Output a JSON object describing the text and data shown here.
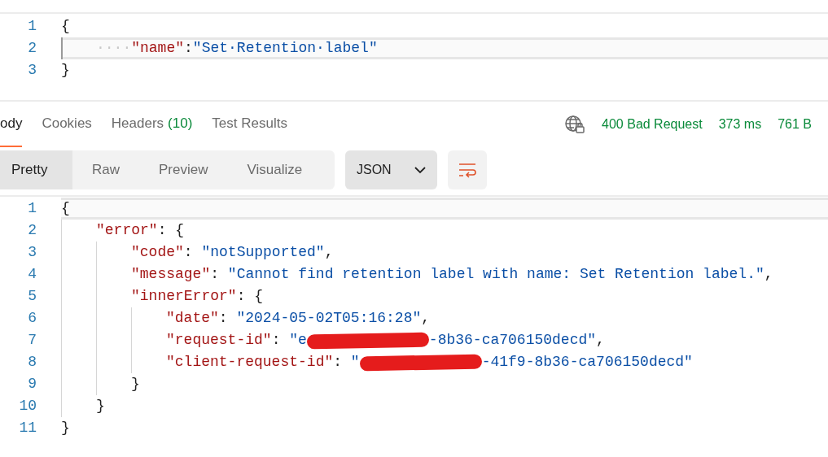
{
  "request_editor": {
    "lines": [
      {
        "number": "1",
        "active": false,
        "tokens": [
          {
            "kind": "open",
            "text": "{"
          }
        ]
      },
      {
        "number": "2",
        "active": true,
        "tokens": [
          {
            "kind": "ws",
            "text": "····"
          },
          {
            "kind": "key",
            "text": "\"name\""
          },
          {
            "kind": "punct",
            "text": ":"
          },
          {
            "kind": "string",
            "text": "\"Set·Retention·label\""
          }
        ]
      },
      {
        "number": "3",
        "active": false,
        "tokens": [
          {
            "kind": "close",
            "text": "}"
          }
        ]
      }
    ]
  },
  "response_tabs": [
    {
      "label": "ody",
      "selected": true
    },
    {
      "label": "Cookies",
      "selected": false
    },
    {
      "label": "Headers",
      "count": "(10)",
      "selected": false
    },
    {
      "label": "Test Results",
      "selected": false
    }
  ],
  "status": {
    "code": "400 Bad Request",
    "time": "373 ms",
    "size": "761 B"
  },
  "view_modes": [
    {
      "label": "Pretty",
      "selected": true
    },
    {
      "label": "Raw",
      "selected": false
    },
    {
      "label": "Preview",
      "selected": false
    },
    {
      "label": "Visualize",
      "selected": false
    }
  ],
  "format_dropdown": {
    "value": "JSON"
  },
  "response_editor": {
    "lines": [
      {
        "number": "1",
        "active": true,
        "tokens": [
          {
            "kind": "open",
            "text": "{"
          }
        ]
      },
      {
        "number": "2",
        "active": false,
        "tokens": [
          {
            "kind": "key",
            "text": "\"error\""
          },
          {
            "kind": "punct",
            "text": ": "
          },
          {
            "kind": "open",
            "text": "{"
          }
        ]
      },
      {
        "number": "3",
        "active": false,
        "tokens": [
          {
            "kind": "key",
            "text": "\"code\""
          },
          {
            "kind": "punct",
            "text": ": "
          },
          {
            "kind": "string",
            "text": "\"notSupported\""
          },
          {
            "kind": "punct",
            "text": ","
          }
        ]
      },
      {
        "number": "4",
        "active": false,
        "tokens": [
          {
            "kind": "key",
            "text": "\"message\""
          },
          {
            "kind": "punct",
            "text": ": "
          },
          {
            "kind": "string",
            "text": "\"Cannot find retention label with name: Set Retention label.\""
          },
          {
            "kind": "punct",
            "text": ","
          }
        ]
      },
      {
        "number": "5",
        "active": false,
        "tokens": [
          {
            "kind": "key",
            "text": "\"innerError\""
          },
          {
            "kind": "punct",
            "text": ": "
          },
          {
            "kind": "open",
            "text": "{"
          }
        ]
      },
      {
        "number": "6",
        "active": false,
        "tokens": [
          {
            "kind": "key",
            "text": "\"date\""
          },
          {
            "kind": "punct",
            "text": ": "
          },
          {
            "kind": "string",
            "text": "\"2024-05-02T05:16:28\""
          },
          {
            "kind": "punct",
            "text": ","
          }
        ]
      },
      {
        "number": "7",
        "active": false,
        "tokens": [
          {
            "kind": "key",
            "text": "\"request-id\""
          },
          {
            "kind": "punct",
            "text": ": "
          },
          {
            "kind": "string",
            "text": "\"e"
          },
          {
            "kind": "redaction"
          },
          {
            "kind": "string",
            "text": "-8b36-ca706150decd\""
          },
          {
            "kind": "punct",
            "text": ","
          }
        ]
      },
      {
        "number": "8",
        "active": false,
        "tokens": [
          {
            "kind": "key",
            "text": "\"client-request-id\""
          },
          {
            "kind": "punct",
            "text": ": "
          },
          {
            "kind": "string",
            "text": "\""
          },
          {
            "kind": "redaction"
          },
          {
            "kind": "string",
            "text": "-41f9-8b36-ca706150decd\""
          }
        ]
      },
      {
        "number": "9",
        "active": false,
        "tokens": [
          {
            "kind": "close",
            "text": "}"
          }
        ]
      },
      {
        "number": "10",
        "active": false,
        "tokens": [
          {
            "kind": "close",
            "text": "}"
          }
        ]
      },
      {
        "number": "11",
        "active": false,
        "tokens": [
          {
            "kind": "close",
            "text": "}"
          }
        ]
      }
    ]
  }
}
